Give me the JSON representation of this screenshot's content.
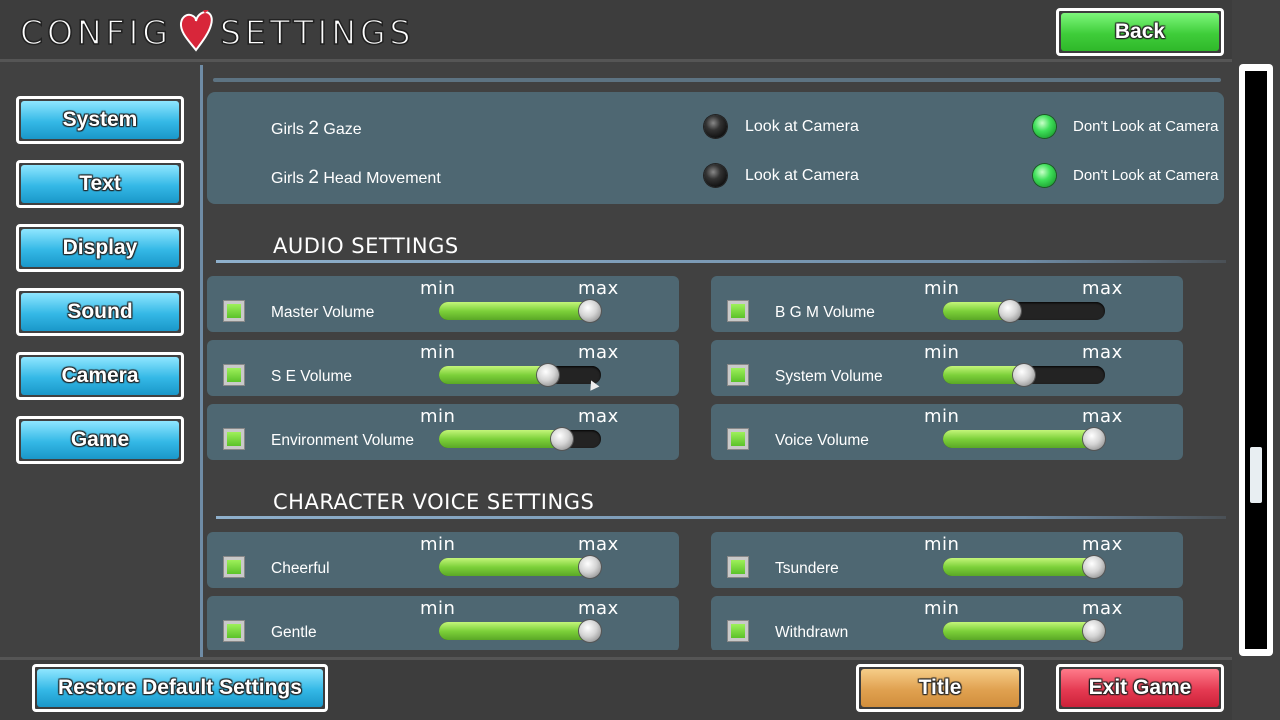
{
  "header": {
    "title_left": "CONFIG",
    "title_right": "SETTINGS",
    "back_label": "Back"
  },
  "nav": {
    "items": [
      {
        "label": "System"
      },
      {
        "label": "Text"
      },
      {
        "label": "Display"
      },
      {
        "label": "Sound"
      },
      {
        "label": "Camera"
      },
      {
        "label": "Game"
      }
    ]
  },
  "gaze": {
    "rows": [
      {
        "label_a": "Girls",
        "label_num": "2",
        "label_b": "Gaze",
        "option_a": "Look at Camera",
        "option_b": "Don't Look at Camera",
        "selected": "option_b"
      },
      {
        "label_a": "Girls",
        "label_num": "2",
        "label_b": "Head Movement",
        "option_a": "Look at Camera",
        "option_b": "Don't Look at Camera",
        "selected": "option_b"
      }
    ]
  },
  "audio": {
    "title": "AUDIO SETTINGS",
    "min_label": "min",
    "max_label": "max",
    "sliders": [
      {
        "label": "Master Volume",
        "value": 1.0,
        "checked": true
      },
      {
        "label": "B G M Volume",
        "value": 0.4,
        "checked": true
      },
      {
        "label": "S E Volume",
        "value": 0.7,
        "checked": true
      },
      {
        "label": "System Volume",
        "value": 0.5,
        "checked": true
      },
      {
        "label": "Environment Volume",
        "value": 0.8,
        "checked": true
      },
      {
        "label": "Voice Volume",
        "value": 1.0,
        "checked": true
      }
    ]
  },
  "character_voice": {
    "title": "CHARACTER VOICE SETTINGS",
    "sliders": [
      {
        "label": "Cheerful",
        "value": 1.0,
        "checked": true
      },
      {
        "label": "Tsundere",
        "value": 1.0,
        "checked": true
      },
      {
        "label": "Gentle",
        "value": 1.0,
        "checked": true
      },
      {
        "label": "Withdrawn",
        "value": 1.0,
        "checked": true
      }
    ]
  },
  "footer": {
    "restore_label": "Restore Default Settings",
    "title_label": "Title",
    "exit_label": "Exit Game"
  },
  "colors": {
    "panel": "#4e6772",
    "green_button": "#3fcd3a",
    "blue_button": "#34b8e6",
    "orange_button": "#e0a150",
    "red_button": "#e53a52",
    "slider_fill": "#7dd13a"
  },
  "scroll_position": 0.72
}
